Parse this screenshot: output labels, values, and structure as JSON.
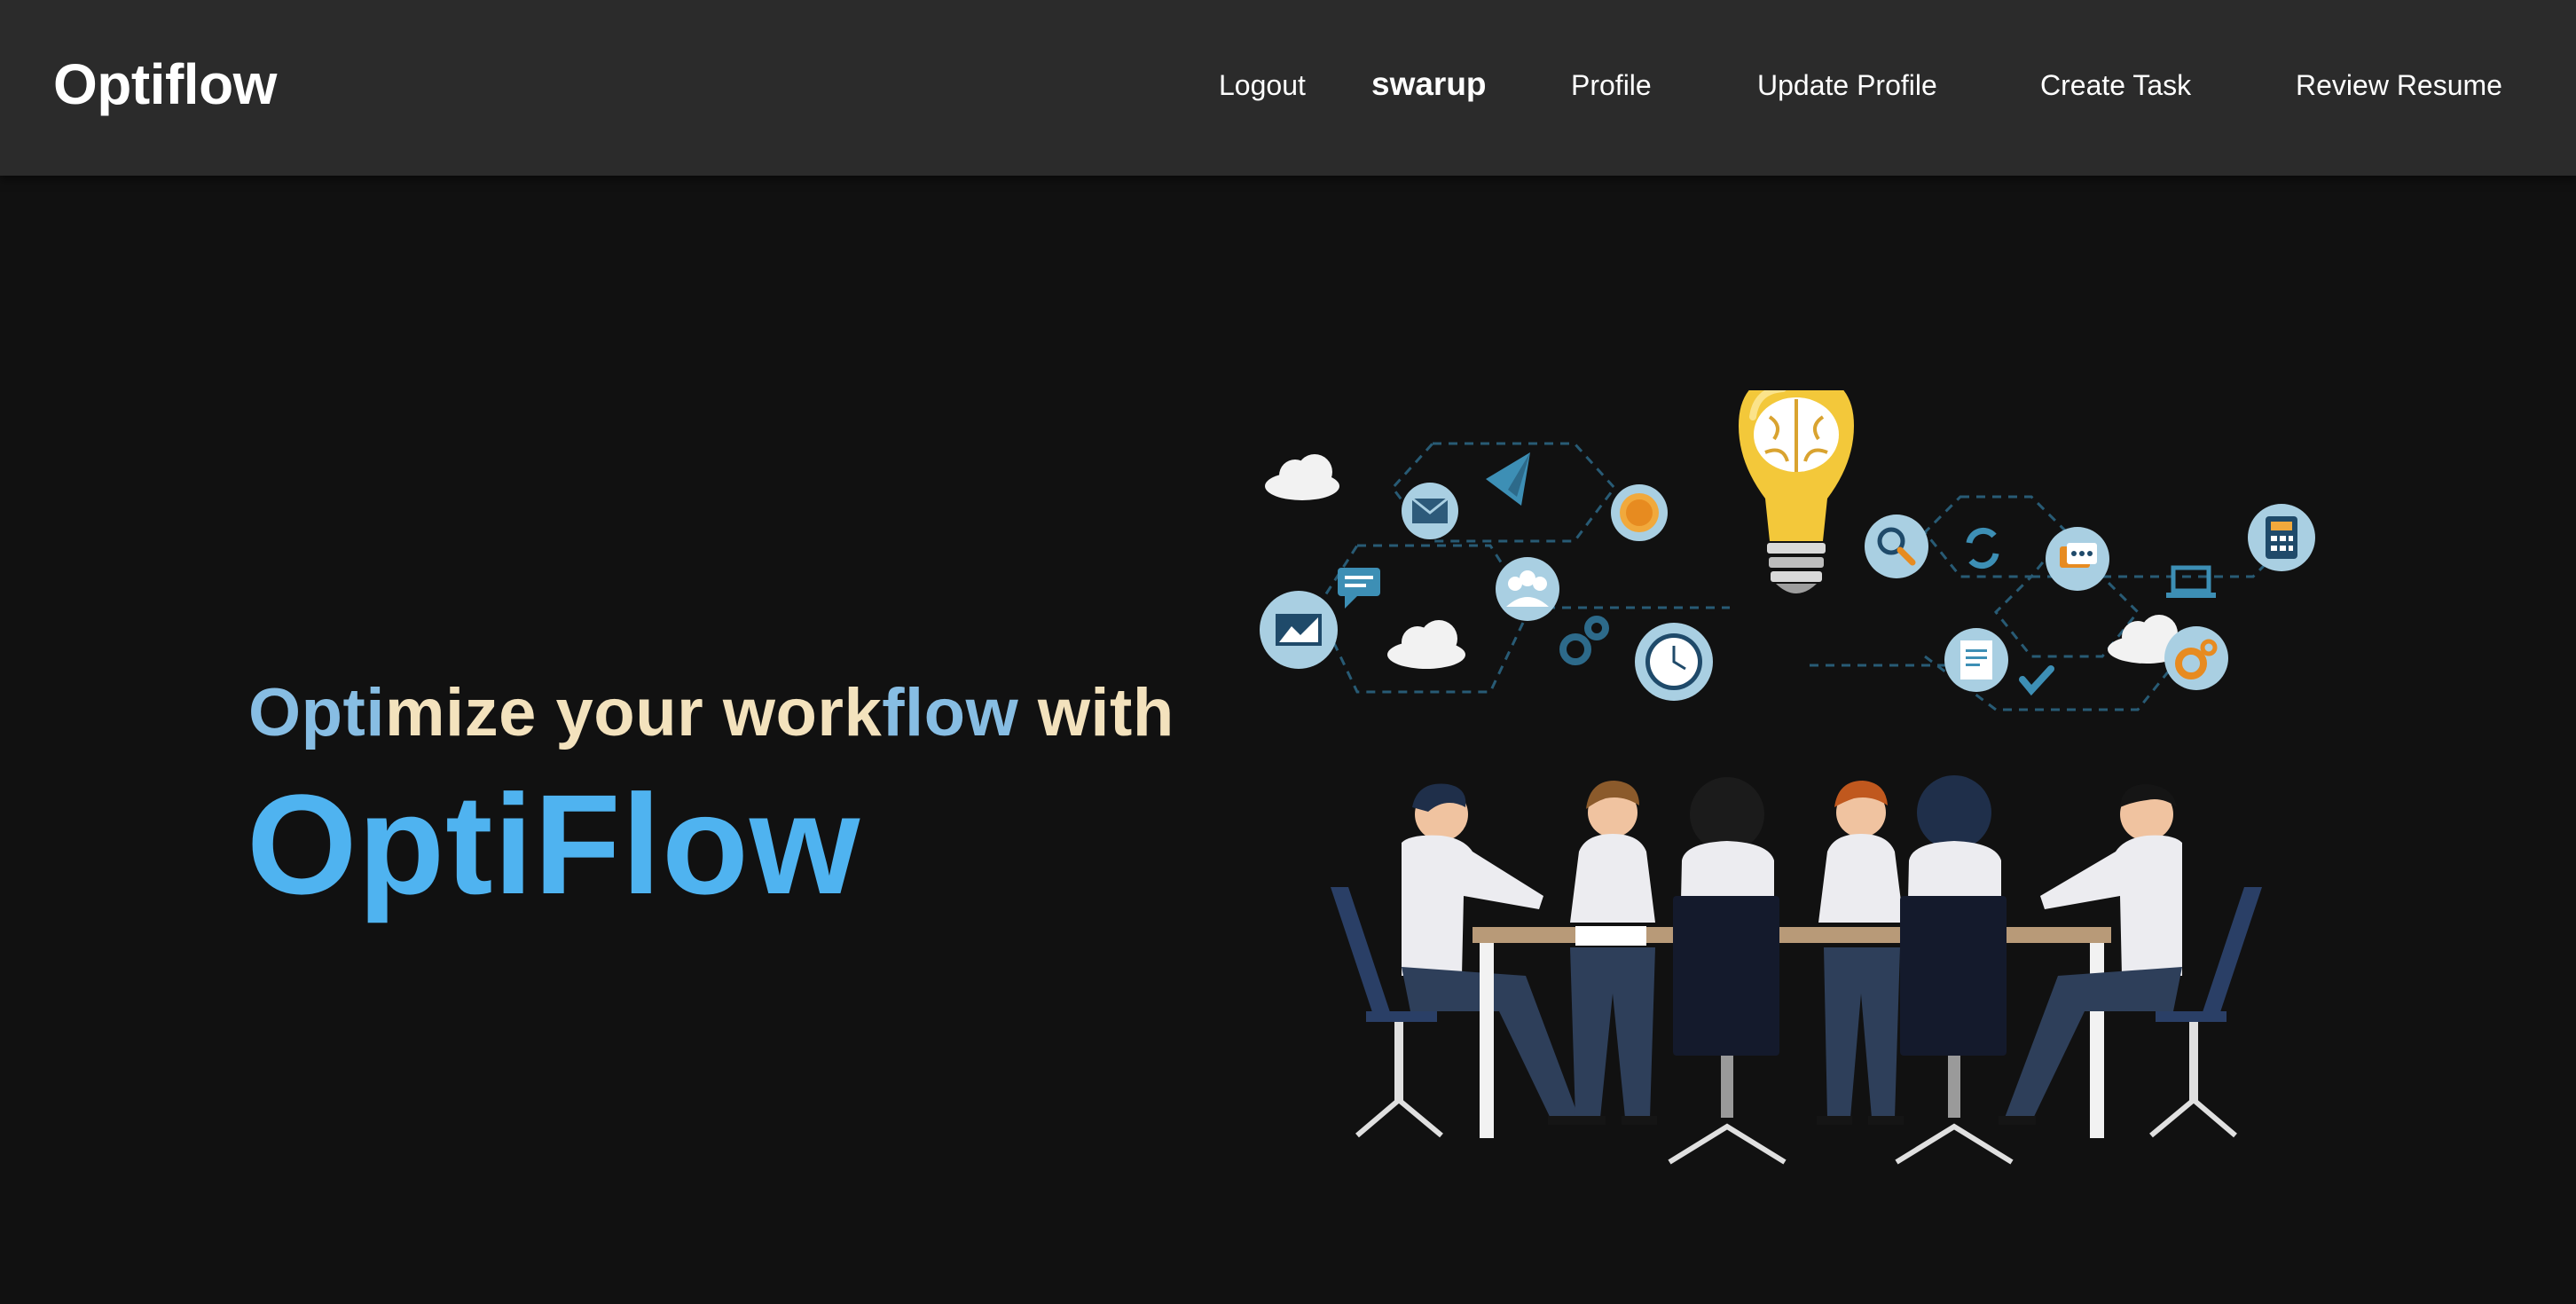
{
  "navbar": {
    "brand": "Optiflow",
    "links": {
      "logout": "Logout",
      "username": "swarup",
      "profile": "Profile",
      "update_profile": "Update Profile",
      "create_task": "Create Task",
      "review_resume": "Review Resume"
    }
  },
  "hero": {
    "tagline_segments": [
      "Opti",
      "mize your work",
      "flow",
      " with"
    ],
    "title": "OptiFlow"
  },
  "illustration": {
    "icons": [
      "cloud-icon",
      "envelope-icon",
      "paper-plane-icon",
      "dollar-coin-icon",
      "chat-bubble-icon",
      "chart-icon",
      "team-icon",
      "gears-icon",
      "clock-icon",
      "lightbulb-brain-icon",
      "magnifier-icon",
      "refresh-icon",
      "document-icon",
      "checkmark-icon",
      "laptop-icon",
      "calculator-icon",
      "settings-icon"
    ]
  },
  "colors": {
    "navbar_bg": "#2b2b2b",
    "page_bg": "#111111",
    "accent_blue": "#4fb3f0",
    "tagline_blue": "#87bde3",
    "tagline_cream": "#f3e2bd"
  }
}
